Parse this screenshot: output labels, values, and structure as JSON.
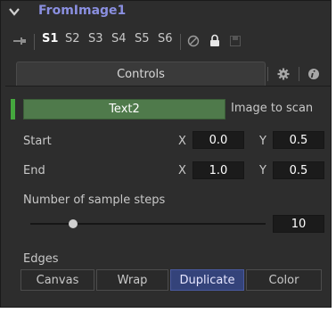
{
  "header": {
    "title": "FromImage1",
    "collapse_icon": "chevron-down-icon"
  },
  "slots": {
    "items": [
      "S1",
      "S2",
      "S3",
      "S4",
      "S5",
      "S6"
    ],
    "active": "S1",
    "icons": [
      "pin-icon",
      "ban-icon",
      "lock-icon",
      "save-icon"
    ]
  },
  "tabs": {
    "controls_label": "Controls",
    "settings_icon": "gear-icon",
    "info_icon": "info-icon"
  },
  "image": {
    "value": "Text2",
    "label": "Image to scan",
    "accent": "#45a83e"
  },
  "start": {
    "label": "Start",
    "x_label": "X",
    "x_value": "0.0",
    "y_label": "Y",
    "y_value": "0.5"
  },
  "end": {
    "label": "End",
    "x_label": "X",
    "x_value": "1.0",
    "y_label": "Y",
    "y_value": "0.5"
  },
  "steps": {
    "label": "Number of sample steps",
    "value": "10",
    "slider_fraction": 0.18
  },
  "edges": {
    "label": "Edges",
    "options": [
      "Canvas",
      "Wrap",
      "Duplicate",
      "Color"
    ],
    "selected": "Duplicate",
    "selected_color": "#34437a"
  },
  "colors": {
    "title": "#8a8fe0",
    "panel_bg": "#2d2d2d"
  }
}
